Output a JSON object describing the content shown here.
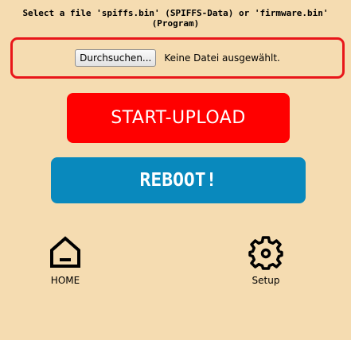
{
  "instruction": {
    "line1": "Select a file 'spiffs.bin' (SPIFFS-Data) or 'firmware.bin'",
    "line2": "(Program)"
  },
  "file_picker": {
    "browse_label": "Durchsuchen...",
    "status": "Keine Datei ausgewählt.",
    "border_color": "#e8161a"
  },
  "upload_button": {
    "label": "START-UPLOAD",
    "color": "#ff0000"
  },
  "reboot_button": {
    "label": "REBOOT!",
    "color": "#0989bd"
  },
  "nav": {
    "home": {
      "label": "HOME",
      "icon": "home-icon"
    },
    "setup": {
      "label": "Setup",
      "icon": "gear-icon"
    }
  },
  "colors": {
    "background": "#f5dcb1"
  }
}
